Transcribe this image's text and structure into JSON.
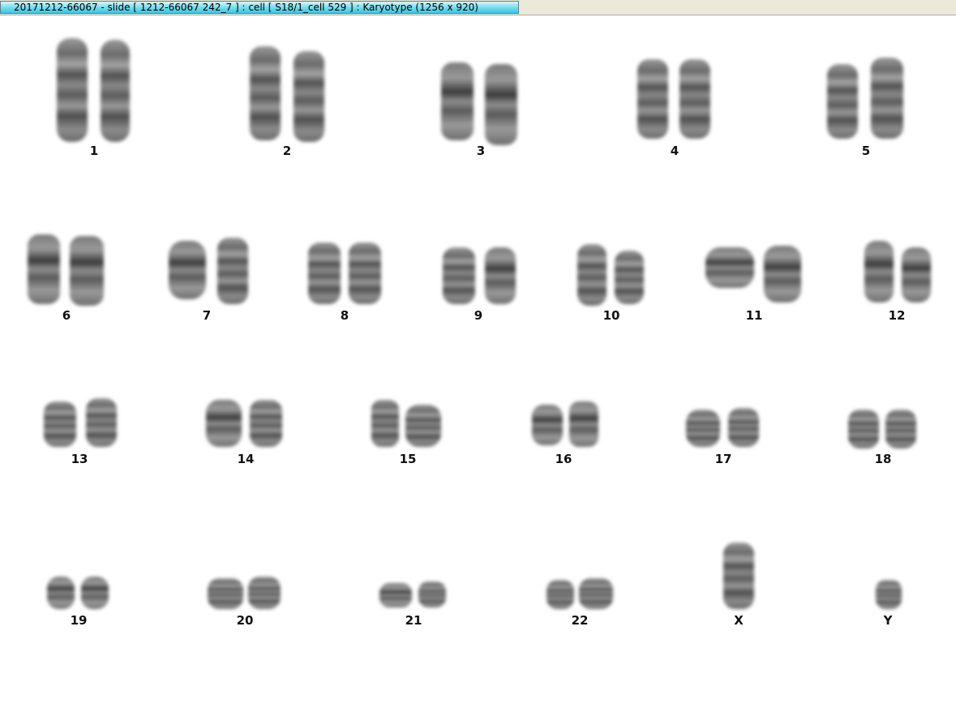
{
  "window": {
    "title": "20171212-66067 - slide [ 1212-66067 242_7 ] : cell [ S18/1_cell 529 ] : Karyotype  (1256 x 920)"
  },
  "karyotype": {
    "labels": [
      "1",
      "2",
      "3",
      "4",
      "5",
      "6",
      "7",
      "8",
      "9",
      "10",
      "11",
      "12",
      "13",
      "14",
      "15",
      "16",
      "17",
      "18",
      "19",
      "20",
      "21",
      "22",
      "X",
      "Y"
    ]
  }
}
